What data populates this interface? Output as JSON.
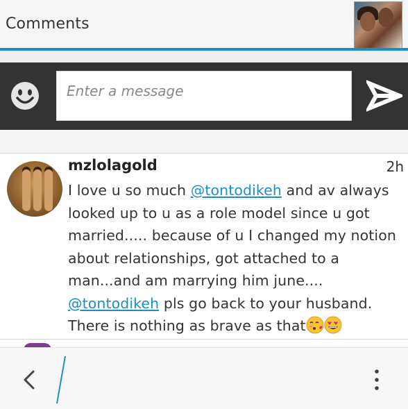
{
  "header": {
    "title": "Comments",
    "avatar_icon": "profile-photo"
  },
  "composer": {
    "emoji_icon": "smiley-face-icon",
    "placeholder": "Enter a message",
    "value": "",
    "send_icon": "send-arrow-icon"
  },
  "comment": {
    "username": "mzlolagold",
    "time": "2h",
    "text_part1": "I love u so much ",
    "mention1": "@tontodikeh",
    "text_part2": " and av always looked up to u as a role model since u got married..... because of u I changed my notion about relationships, got attached to a man...and am marrying him june.... ",
    "mention2": "@tontodikeh",
    "text_part3": " pls go back to your husband. There is nothing as brave as that",
    "emojis": [
      "kissing-face-with-heart-icon",
      "heart-eyes-face-icon"
    ]
  },
  "bottom_nav": {
    "back_icon": "chevron-left-icon",
    "menu_icon": "more-vertical-icon"
  },
  "colors": {
    "accent": "#1a8fc7",
    "composer_bg": "#333333",
    "header_bg": "#f6f6f6"
  }
}
